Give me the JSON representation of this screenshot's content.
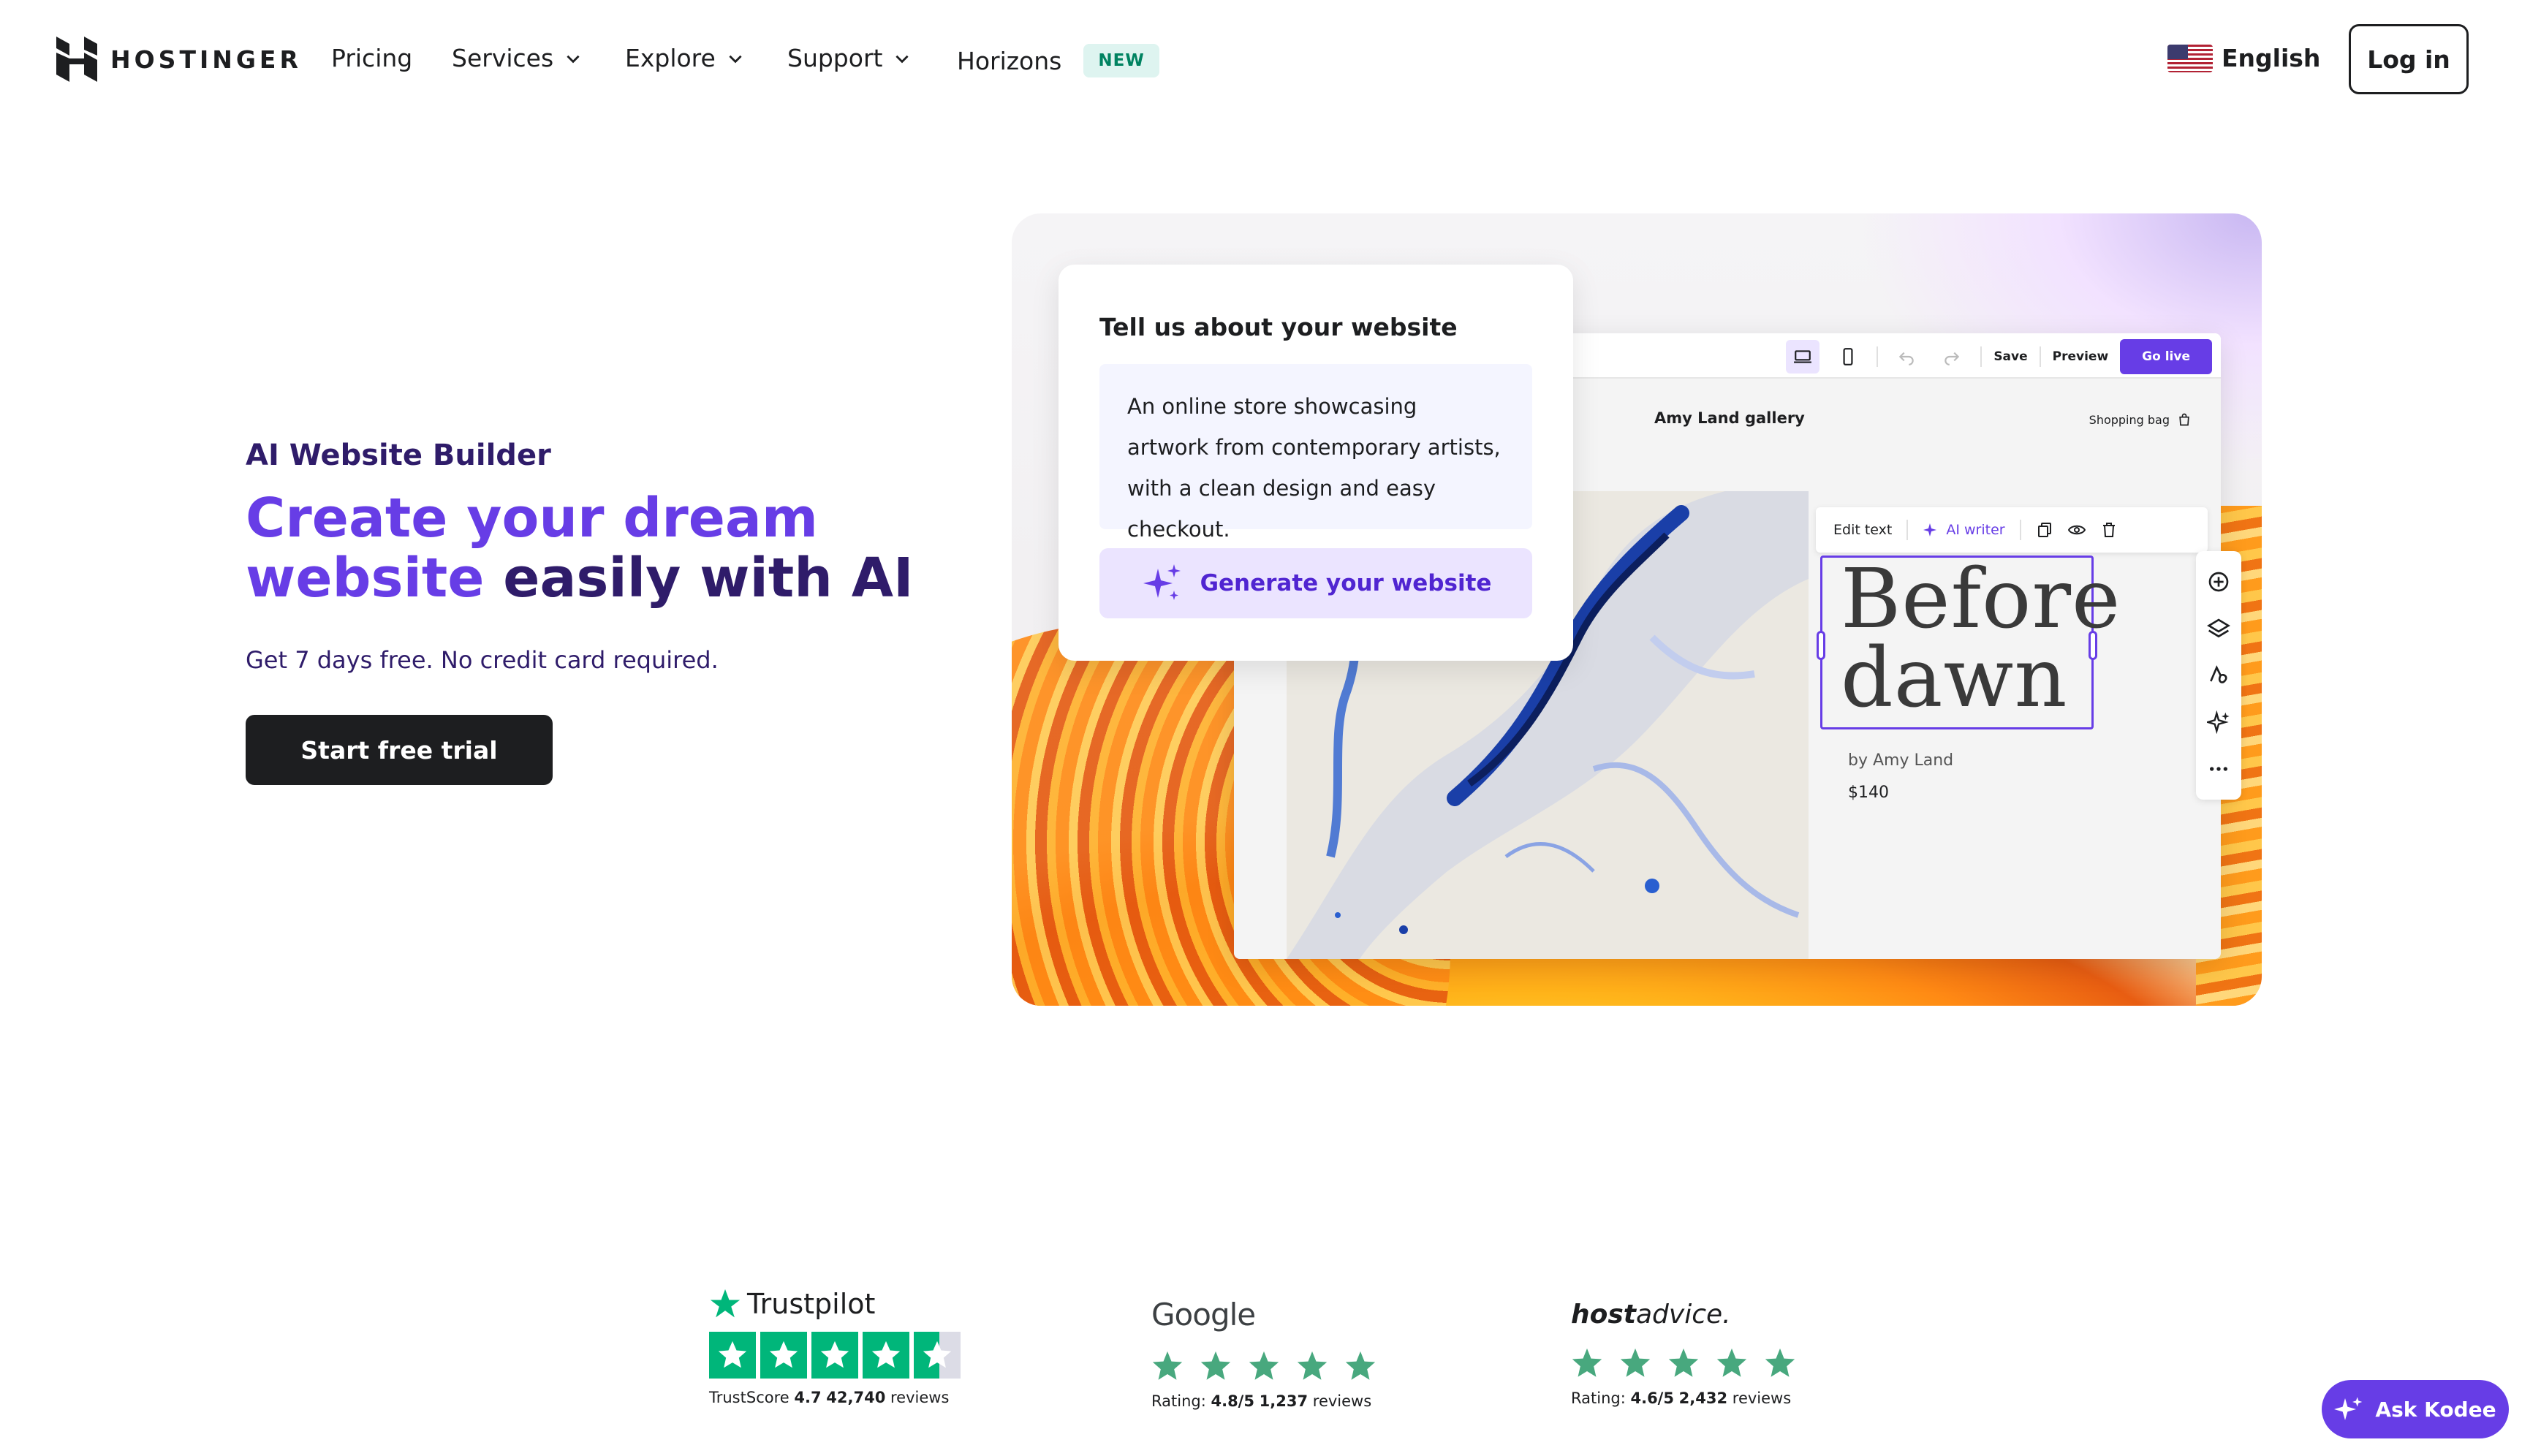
{
  "nav": {
    "brand": "HOSTINGER",
    "items": [
      {
        "label": "Pricing",
        "dropdown": false
      },
      {
        "label": "Services",
        "dropdown": true
      },
      {
        "label": "Explore",
        "dropdown": true
      },
      {
        "label": "Support",
        "dropdown": true
      },
      {
        "label": "Horizons",
        "dropdown": false,
        "badge": "NEW"
      }
    ],
    "language": "English",
    "login_label": "Log in"
  },
  "hero": {
    "eyebrow": "AI Website Builder",
    "headline_accent": "Create your dream website",
    "headline_accent_line1": "Create your dream",
    "headline_accent_line2": "website",
    "headline_rest": "easily with AI",
    "subtext": "Get 7 days free. No credit card required.",
    "cta_label": "Start free trial"
  },
  "mockup": {
    "prompt_title": "Tell us about your website",
    "prompt_text": "An online store showcasing artwork from contemporary artists, with a clean design and easy checkout.",
    "generate_label": "Generate your website",
    "editor": {
      "save": "Save",
      "preview": "Preview",
      "go_live": "Go live",
      "site_title": "Amy Land gallery",
      "shopping_bag": "Shopping bag",
      "edit_text": "Edit text",
      "ai_writer": "AI writer",
      "artwork_title_line1": "Before",
      "artwork_title_line2": "dawn",
      "artist": "by Amy Land",
      "price": "$140"
    }
  },
  "ratings": {
    "trustpilot": {
      "brand": "Trustpilot",
      "score_label": "TrustScore",
      "score": "4.7",
      "count": "42,740",
      "reviews_label": "reviews",
      "stars": 4.5
    },
    "google": {
      "brand": "Google",
      "rating_label": "Rating:",
      "rating": "4.8/5",
      "count": "1,237",
      "reviews_label": "reviews",
      "stars": 5
    },
    "hostadvice": {
      "brand_bold": "host",
      "brand_rest": "advice.",
      "rating_label": "Rating:",
      "rating": "4.6/5",
      "count": "2,432",
      "reviews_label": "reviews",
      "stars": 5
    }
  },
  "assistant": {
    "label": "Ask Kodee"
  },
  "colors": {
    "brand_purple": "#673de6",
    "dark_purple": "#2f1c6a",
    "trust_green": "#00b67a",
    "star_green": "#48a87e"
  }
}
